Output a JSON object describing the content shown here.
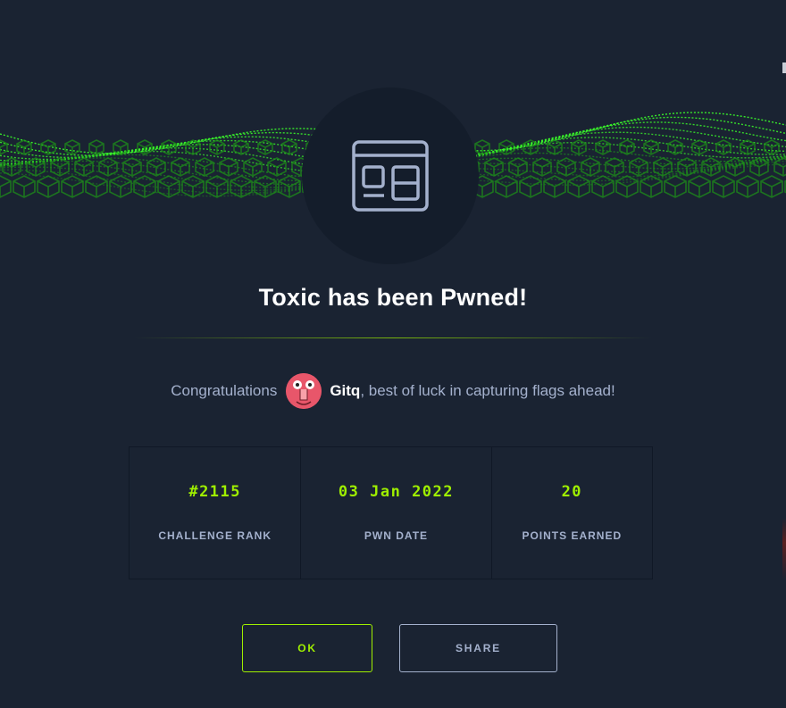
{
  "modal": {
    "challenge_icon": "browser-window-icon",
    "title": "Toxic has been Pwned!",
    "congrats_prefix": "Congratulations",
    "username": "Gitq",
    "congrats_suffix": ", best of luck in capturing flags ahead!",
    "avatar_icon": "user-avatar-icon"
  },
  "stats": [
    {
      "value": "#2115",
      "label": "CHALLENGE RANK"
    },
    {
      "value": "03 Jan 2022",
      "label": "PWN DATE"
    },
    {
      "value": "20",
      "label": "POINTS EARNED"
    }
  ],
  "buttons": {
    "ok_label": "OK",
    "share_label": "SHARE"
  },
  "colors": {
    "background": "#1a2332",
    "accent": "#9fef00",
    "muted_text": "#a4b1cd",
    "circle": "#141d2b"
  }
}
